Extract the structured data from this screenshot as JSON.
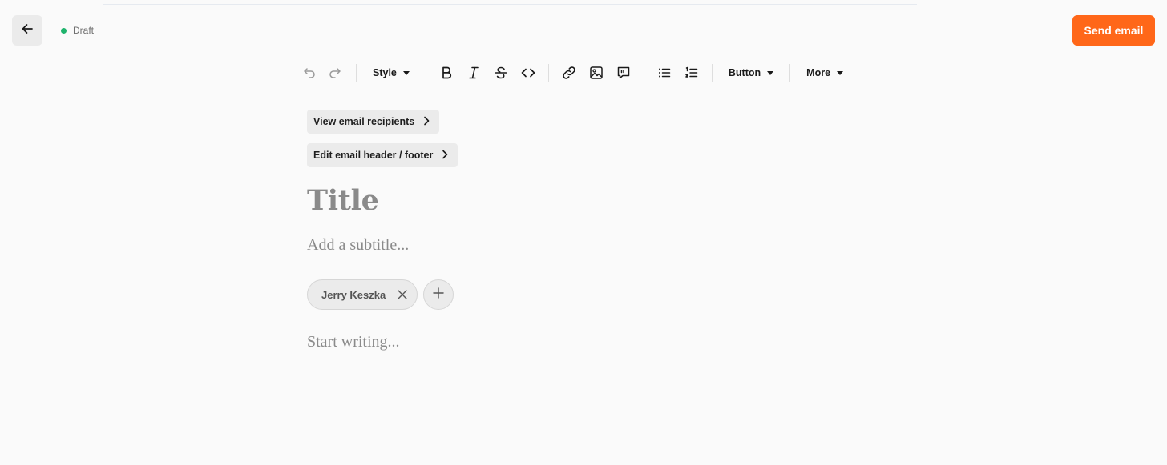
{
  "header": {
    "status_label": "Draft",
    "status_color": "#1fb36c",
    "send_label": "Send email",
    "send_color": "#ff6719",
    "back_icon": "arrow-left-icon"
  },
  "toolbar": {
    "style_label": "Style",
    "button_label": "Button",
    "more_label": "More",
    "icons": [
      "undo-icon",
      "redo-icon",
      "bold-icon",
      "italic-icon",
      "strikethrough-icon",
      "code-icon",
      "link-icon",
      "image-icon",
      "quote-icon",
      "bullet-list-icon",
      "numbered-list-icon"
    ]
  },
  "settings": {
    "recipients_label": "View email recipients",
    "header_footer_label": "Edit email header / footer"
  },
  "editor": {
    "title_placeholder": "Title",
    "subtitle_placeholder": "Add a subtitle...",
    "body_placeholder": "Start writing..."
  },
  "authors": [
    {
      "name": "Jerry Keszka"
    }
  ]
}
